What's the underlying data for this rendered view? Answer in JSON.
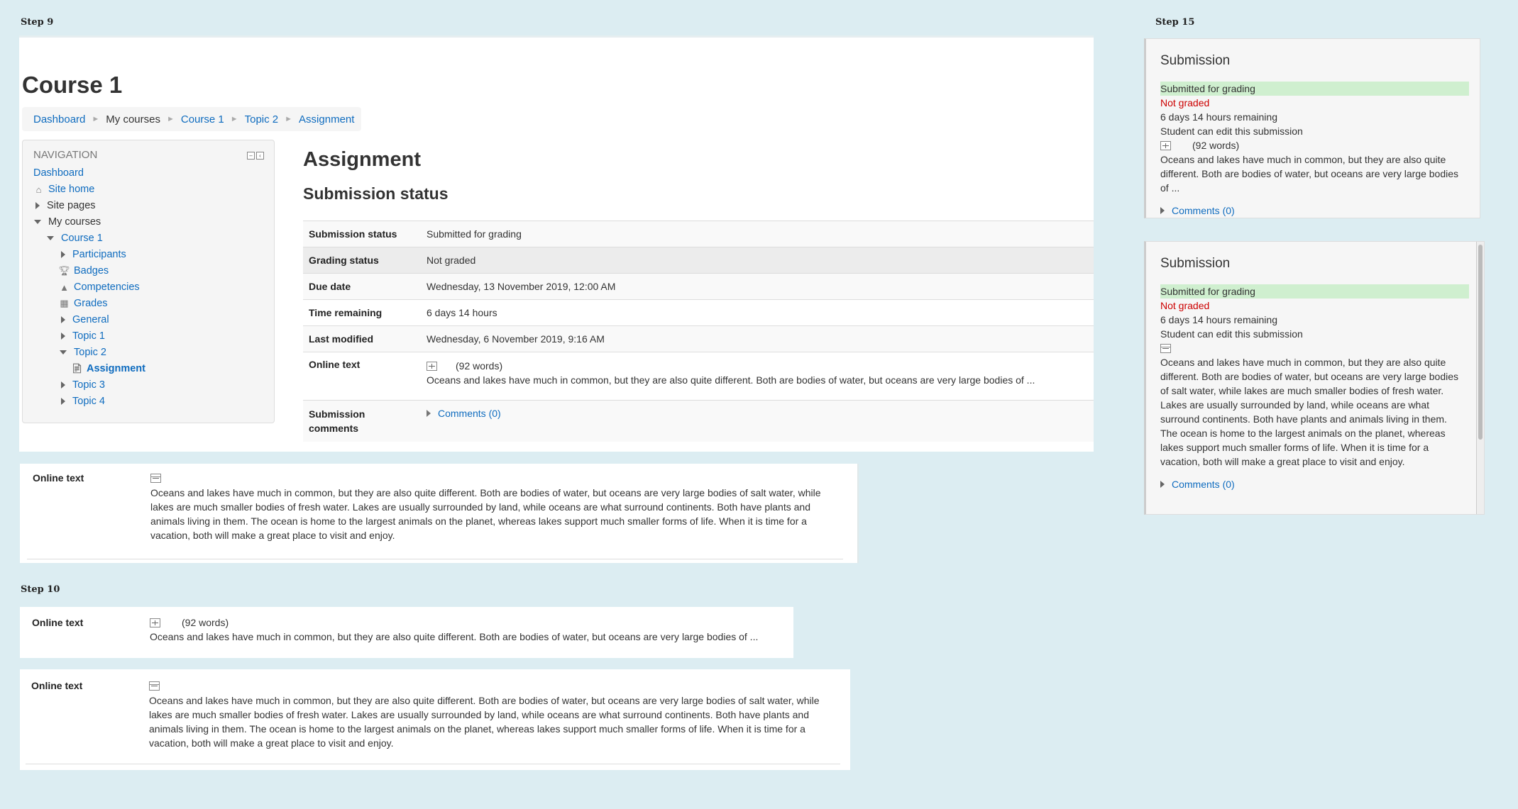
{
  "steps": {
    "step9": "Step 9",
    "step10": "Step 10",
    "step15": "Step 15"
  },
  "course_title": "Course 1",
  "breadcrumb": [
    "Dashboard",
    "My courses",
    "Course 1",
    "Topic 2",
    "Assignment"
  ],
  "navigation": {
    "header": "NAVIGATION",
    "items": [
      {
        "label": "Dashboard"
      },
      {
        "label": "Site home"
      },
      {
        "label": "Site pages"
      },
      {
        "label": "My courses"
      },
      {
        "label": "Course 1"
      },
      {
        "label": "Participants"
      },
      {
        "label": "Badges"
      },
      {
        "label": "Competencies"
      },
      {
        "label": "Grades"
      },
      {
        "label": "General"
      },
      {
        "label": "Topic 1"
      },
      {
        "label": "Topic 2"
      },
      {
        "label": "Assignment"
      },
      {
        "label": "Topic 3"
      },
      {
        "label": "Topic 4"
      }
    ]
  },
  "assignment": {
    "title": "Assignment",
    "submission_status_heading": "Submission status",
    "rows": [
      {
        "label": "Submission status",
        "value": "Submitted for grading"
      },
      {
        "label": "Grading status",
        "value": "Not graded"
      },
      {
        "label": "Due date",
        "value": "Wednesday, 13 November 2019, 12:00 AM"
      },
      {
        "label": "Time remaining",
        "value": "6 days 14 hours"
      },
      {
        "label": "Last modified",
        "value": "Wednesday, 6 November 2019, 9:16 AM"
      }
    ],
    "online_text_label": "Online text",
    "word_count": "(92 words)",
    "summary_text": "Oceans and lakes have much in common, but they are also quite different. Both are bodies of water, but oceans are very large bodies of ...",
    "submission_comments_label_1": "Submission",
    "submission_comments_label_2": "comments",
    "comments_link": "Comments (0)"
  },
  "online_text_full": {
    "label": "Online text",
    "line1": "Oceans and lakes have much in common, but they are also quite different. Both are bodies of water, but oceans are very large bodies of salt water, while",
    "line2": "lakes are much smaller bodies of fresh water. Lakes are usually surrounded by land, while oceans are what surround continents. Both have plants and",
    "line3": "animals living in them. The ocean is home to the largest animals on the planet, whereas lakes support much smaller forms of life. When it is time for a",
    "line4": "vacation, both will make a great place to visit and enjoy."
  },
  "side_collapsed": {
    "title": "Submission",
    "status": "Submitted for grading",
    "grading": "Not graded",
    "remaining": "6 days 14 hours remaining",
    "edit": "Student can edit this submission",
    "word_count": "(92 words)",
    "line1": "Oceans and lakes have much in common, but they are also quite",
    "line2": "different. Both are bodies of water, but oceans are very large bodies",
    "line3": "of ...",
    "comments": "Comments (0)"
  },
  "side_expanded": {
    "title": "Submission",
    "status": "Submitted for grading",
    "grading": "Not graded",
    "remaining": "6 days 14 hours remaining",
    "edit": "Student can edit this submission",
    "lines": [
      "Oceans and lakes have much in common, but they are also quite",
      "different. Both are bodies of water, but oceans are very large bodies",
      "of salt water, while lakes are much smaller bodies of fresh water.",
      "Lakes are usually surrounded by land, while oceans are what",
      "surround continents. Both have plants and animals living in them.",
      "The ocean is home to the largest animals on the planet, whereas",
      "lakes support much smaller forms of life. When it is time for a",
      "vacation, both will make a great place to visit and enjoy."
    ],
    "comments": "Comments (0)"
  },
  "colors": {
    "background": "#dcedf2",
    "link": "#0f6cbf",
    "submitted_bg": "#cfefcf",
    "not_graded": "#cc0000"
  }
}
